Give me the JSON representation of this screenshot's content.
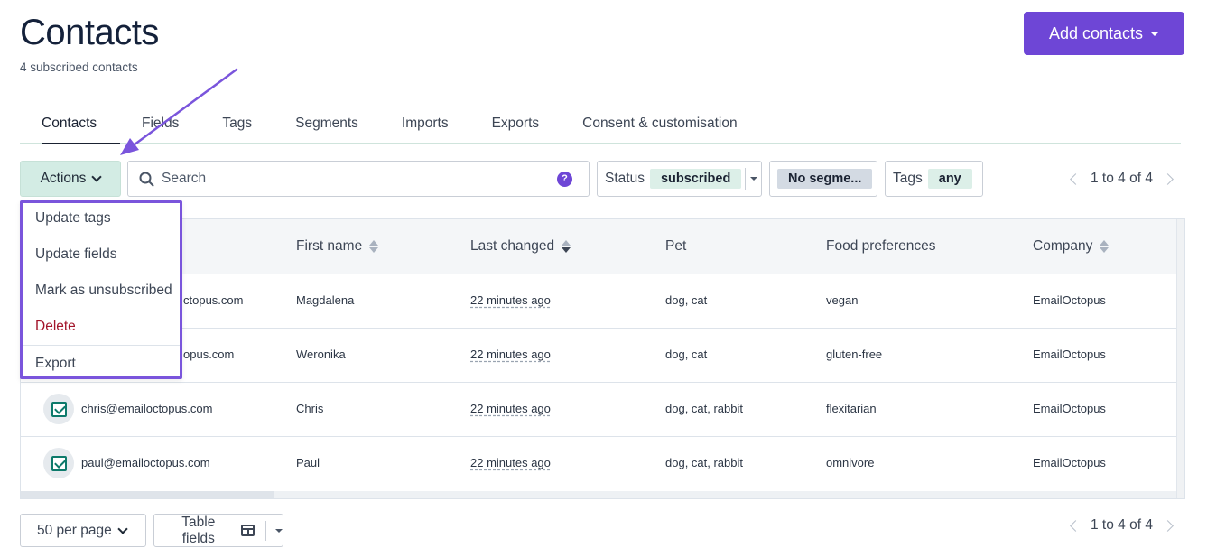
{
  "header": {
    "title": "Contacts",
    "subtitle": "4 subscribed contacts",
    "add_button_label": "Add contacts"
  },
  "tabs": [
    {
      "label": "Contacts",
      "active": true
    },
    {
      "label": "Fields",
      "active": false
    },
    {
      "label": "Tags",
      "active": false
    },
    {
      "label": "Segments",
      "active": false
    },
    {
      "label": "Imports",
      "active": false
    },
    {
      "label": "Exports",
      "active": false
    },
    {
      "label": "Consent & customisation",
      "active": false
    }
  ],
  "toolbar": {
    "actions_label": "Actions",
    "search_placeholder": "Search",
    "search_value": "",
    "status_label": "Status",
    "status_value": "subscribed",
    "segment_value": "No segme...",
    "tags_label": "Tags",
    "tags_value": "any",
    "pagination": "1 to 4 of 4"
  },
  "actions_menu": [
    {
      "label": "Update tags"
    },
    {
      "label": "Update fields"
    },
    {
      "label": "Mark as unsubscribed"
    },
    {
      "label": "Delete",
      "danger": true
    },
    {
      "label": "Export"
    }
  ],
  "table": {
    "columns": [
      "First name",
      "Last changed",
      "Pet",
      "Food preferences",
      "Company"
    ],
    "rows": [
      {
        "email": "ctopus.com",
        "first_name": "Magdalena",
        "last_changed": "22 minutes ago",
        "pet": "dog, cat",
        "food": "vegan",
        "company": "EmailOctopus",
        "checked": true
      },
      {
        "email": "opus.com",
        "first_name": "Weronika",
        "last_changed": "22 minutes ago",
        "pet": "dog, cat",
        "food": "gluten-free",
        "company": "EmailOctopus",
        "checked": true
      },
      {
        "email": "chris@emailoctopus.com",
        "first_name": "Chris",
        "last_changed": "22 minutes ago",
        "pet": "dog, cat, rabbit",
        "food": "flexitarian",
        "company": "EmailOctopus",
        "checked": true
      },
      {
        "email": "paul@emailoctopus.com",
        "first_name": "Paul",
        "last_changed": "22 minutes ago",
        "pet": "dog, cat, rabbit",
        "food": "omnivore",
        "company": "EmailOctopus",
        "checked": true
      }
    ]
  },
  "footer": {
    "per_page_label": "50 per page",
    "table_fields_label": "Table fields",
    "pagination": "1 to 4 of 4"
  },
  "colors": {
    "accent": "#6e46d6",
    "menu_highlight": "#7a55dc",
    "danger": "#a3142a",
    "check": "#0d7a6b"
  }
}
